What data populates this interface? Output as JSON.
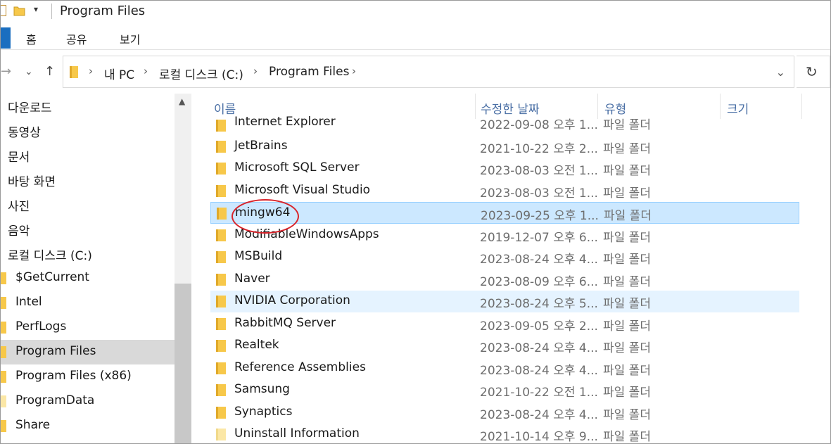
{
  "window": {
    "title": "Program Files"
  },
  "ribbon": {
    "tabs": [
      "홈",
      "공유",
      "보기"
    ]
  },
  "address": {
    "crumbs": [
      "내 PC",
      "로컬 디스크 (C:)",
      "Program Files"
    ]
  },
  "nav_pane": {
    "items": [
      {
        "label": "다운로드",
        "icon": "none"
      },
      {
        "label": "동영상",
        "icon": "none"
      },
      {
        "label": "문서",
        "icon": "none"
      },
      {
        "label": "바탕 화면",
        "icon": "none"
      },
      {
        "label": "사진",
        "icon": "none"
      },
      {
        "label": "음악",
        "icon": "none"
      },
      {
        "label": "로컬 디스크 (C:)",
        "icon": "none"
      },
      {
        "label": "$GetCurrent",
        "icon": "folder"
      },
      {
        "label": "Intel",
        "icon": "folder"
      },
      {
        "label": "PerfLogs",
        "icon": "folder"
      },
      {
        "label": "Program Files",
        "icon": "folder",
        "selected": true
      },
      {
        "label": "Program Files (x86)",
        "icon": "folder"
      },
      {
        "label": "ProgramData",
        "icon": "folder-light"
      },
      {
        "label": "Share",
        "icon": "folder"
      }
    ]
  },
  "columns": {
    "name": "이름",
    "modified": "수정한 날짜",
    "type": "유형",
    "size": "크기"
  },
  "files": [
    {
      "name": "Internet Explorer",
      "modified": "2022-09-08 오후 1...",
      "type": "파일 폴더"
    },
    {
      "name": "JetBrains",
      "modified": "2021-10-22 오후 2...",
      "type": "파일 폴더"
    },
    {
      "name": "Microsoft SQL Server",
      "modified": "2023-08-03 오전 1...",
      "type": "파일 폴더"
    },
    {
      "name": "Microsoft Visual Studio",
      "modified": "2023-08-03 오전 1...",
      "type": "파일 폴더"
    },
    {
      "name": "mingw64",
      "modified": "2023-09-25 오후 1...",
      "type": "파일 폴더",
      "state": "selected"
    },
    {
      "name": "ModifiableWindowsApps",
      "modified": "2019-12-07 오후 6...",
      "type": "파일 폴더"
    },
    {
      "name": "MSBuild",
      "modified": "2023-08-24 오후 4...",
      "type": "파일 폴더"
    },
    {
      "name": "Naver",
      "modified": "2023-08-09 오후 6...",
      "type": "파일 폴더"
    },
    {
      "name": "NVIDIA Corporation",
      "modified": "2023-08-24 오후 5...",
      "type": "파일 폴더",
      "state": "hover"
    },
    {
      "name": "RabbitMQ Server",
      "modified": "2023-09-05 오후 2...",
      "type": "파일 폴더"
    },
    {
      "name": "Realtek",
      "modified": "2023-08-24 오후 4...",
      "type": "파일 폴더"
    },
    {
      "name": "Reference Assemblies",
      "modified": "2023-08-24 오후 4...",
      "type": "파일 폴더"
    },
    {
      "name": "Samsung",
      "modified": "2021-10-22 오전 1...",
      "type": "파일 폴더"
    },
    {
      "name": "Synaptics",
      "modified": "2023-08-24 오후 4...",
      "type": "파일 폴더"
    },
    {
      "name": "Uninstall Information",
      "modified": "2021-10-14 오후 9...",
      "type": "파일 폴더",
      "icon": "folder-light"
    }
  ],
  "colors": {
    "folder": "#f7c84a",
    "folder_light": "#fbe7a6",
    "selection": "#cce8ff",
    "hover": "#e5f3ff",
    "annotation": "#d8232a",
    "header_text": "#4a6fa5"
  },
  "annotation": {
    "shape": "ellipse",
    "target": "mingw64"
  }
}
